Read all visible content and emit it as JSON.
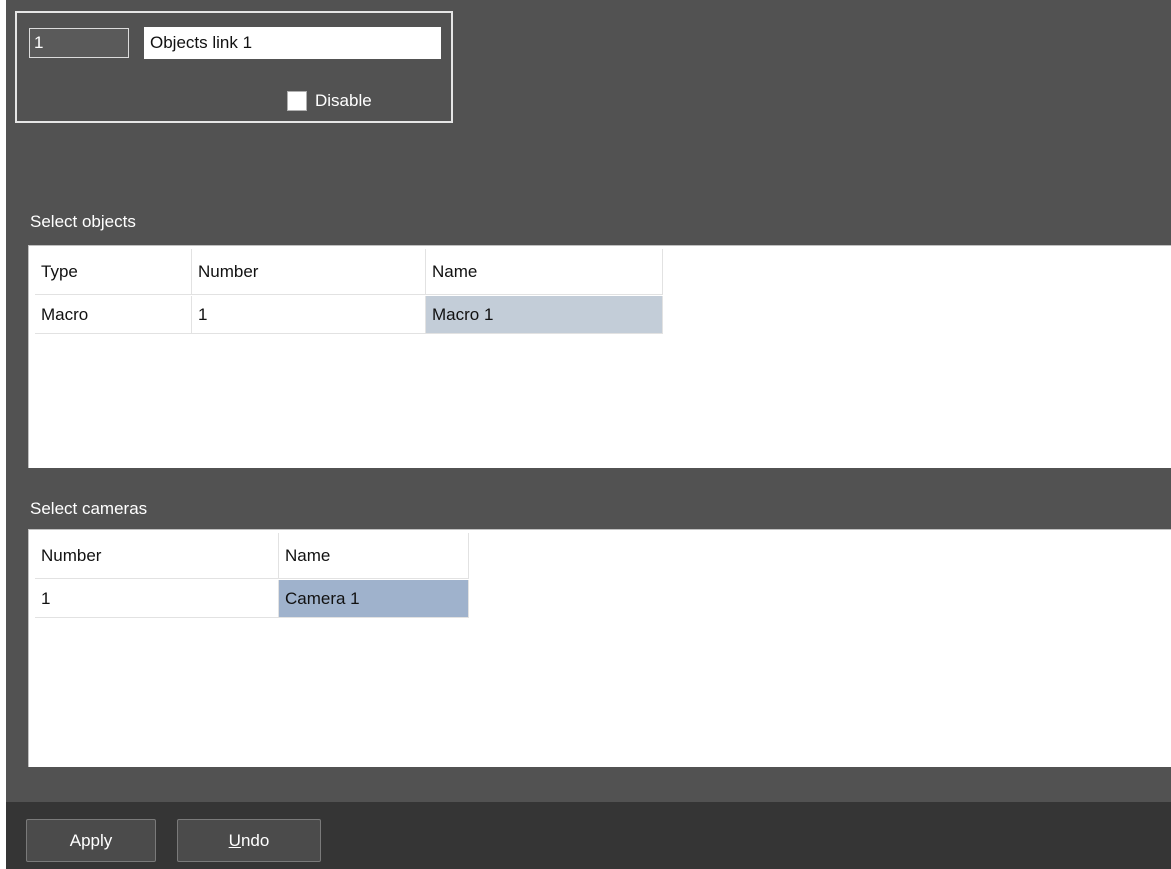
{
  "header": {
    "id_value": "1",
    "name_value": "Objects link 1",
    "disable_label": "Disable"
  },
  "objects": {
    "label": "Select objects",
    "columns": [
      "Type",
      "Number",
      "Name"
    ],
    "rows": [
      [
        "Macro",
        "1",
        "Macro 1"
      ]
    ]
  },
  "cameras": {
    "label": "Select cameras",
    "columns": [
      "Number",
      "Name"
    ],
    "rows": [
      [
        "1",
        "Camera 1"
      ]
    ]
  },
  "footer": {
    "apply_label": "Apply",
    "undo_accel": "U",
    "undo_rest": "ndo"
  },
  "colors": {
    "window_bg": "#525252",
    "footer_bg": "#353535",
    "selected_cell": "#c3cdd8",
    "selected_cell_camera": "#9fb2cc"
  }
}
